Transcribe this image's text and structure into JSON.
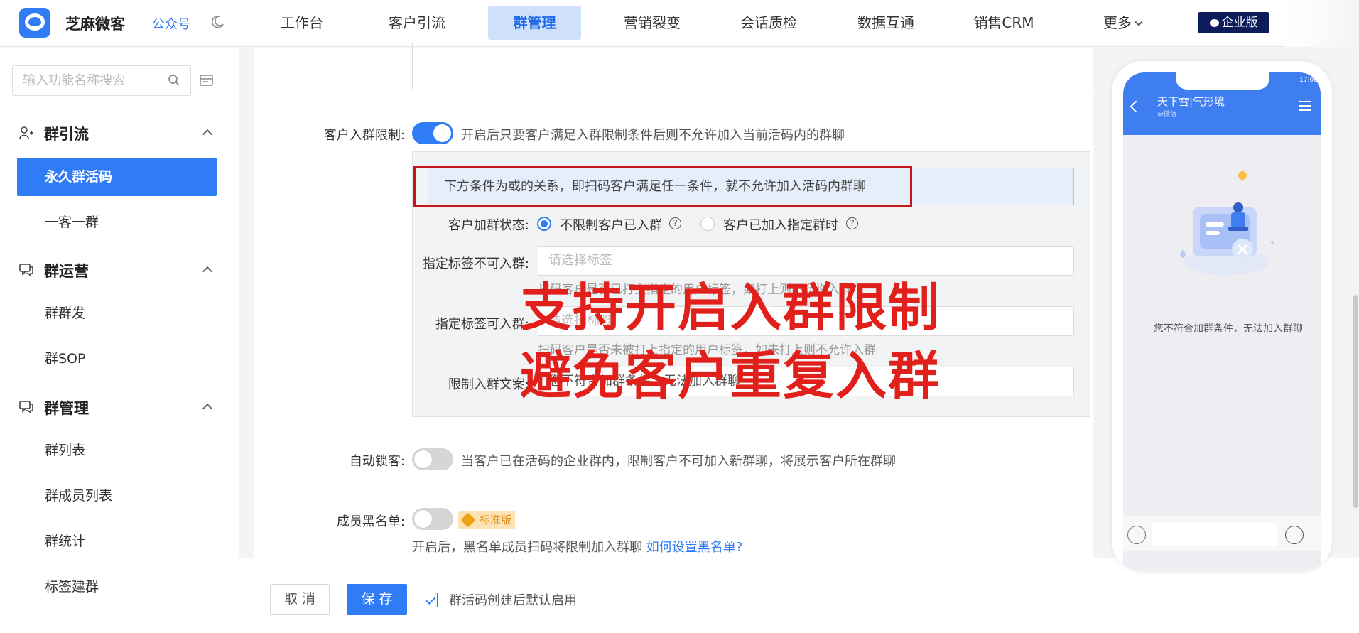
{
  "brand": {
    "name": "芝麻微客",
    "gzh_link": "公众号",
    "accent": "#2f7cf6"
  },
  "nav": {
    "items": [
      {
        "label": "工作台"
      },
      {
        "label": "客户引流"
      },
      {
        "label": "群管理"
      },
      {
        "label": "营销裂变"
      },
      {
        "label": "会话质检"
      },
      {
        "label": "数据互通"
      },
      {
        "label": "销售CRM"
      },
      {
        "label": "更多"
      }
    ],
    "active": "群管理",
    "edition": "企业版"
  },
  "sidebar": {
    "search_placeholder": "输入功能名称搜索",
    "groups": [
      {
        "title": "群引流",
        "items": [
          {
            "label": "永久群活码"
          },
          {
            "label": "一客一群"
          }
        ]
      },
      {
        "title": "群运营",
        "items": [
          {
            "label": "群群发"
          },
          {
            "label": "群SOP"
          }
        ]
      },
      {
        "title": "群管理",
        "items": [
          {
            "label": "群列表"
          },
          {
            "label": "群成员列表"
          },
          {
            "label": "群统计"
          },
          {
            "label": "标签建群"
          }
        ]
      }
    ],
    "active_item": "永久群活码"
  },
  "form": {
    "join_limit": {
      "label": "客户入群限制:",
      "enabled": true,
      "hint": "开启后只要客户满足入群限制条件后则不允许加入当前活码内的群聊"
    },
    "conditions": {
      "banner": "下方条件为或的关系，即扫码客户满足任一条件，就不允许加入活码内群聊",
      "join_status": {
        "label": "客户加群状态:",
        "options": [
          {
            "label": "不限制客户已入群",
            "checked": true
          },
          {
            "label": "客户已加入指定群时",
            "checked": false
          }
        ]
      },
      "tag_forbid": {
        "label": "指定标签不可入群:",
        "placeholder": "请选择标签",
        "hint": "扫码客户是否已打上指定的用户标签，如打上则不允许入群"
      },
      "tag_allow": {
        "label": "指定标签可入群:",
        "placeholder": "请选择标签",
        "hint": "扫码客户是否未被打上指定的用户标签，如未打上则不允许入群"
      },
      "limit_text": {
        "label": "限制入群文案:",
        "value": "您不符合加群条件，无法加入群聊"
      }
    },
    "auto_lock": {
      "label": "自动锁客:",
      "enabled": false,
      "hint": "当客户已在活码的企业群内，限制客户不可加入新群聊，将展示客户所在群聊"
    },
    "blacklist": {
      "label": "成员黑名单:",
      "enabled": false,
      "badge": "标准版",
      "hint": "开启后，黑名单成员扫码将限制加入群聊",
      "link": "如何设置黑名单?"
    }
  },
  "overlay": {
    "line1": "支持开启入群限制",
    "line2": "避免客户重复入群",
    "color": "#e2201b"
  },
  "footer": {
    "cancel": "取 消",
    "save": "保 存",
    "default_enable_label": "群活码创建后默认启用",
    "default_enable_checked": true
  },
  "phone": {
    "title": "天下雪|气形境",
    "subtitle": "@微信",
    "status_time": "17:00",
    "message": "您不符合加群条件，无法加入群聊"
  }
}
